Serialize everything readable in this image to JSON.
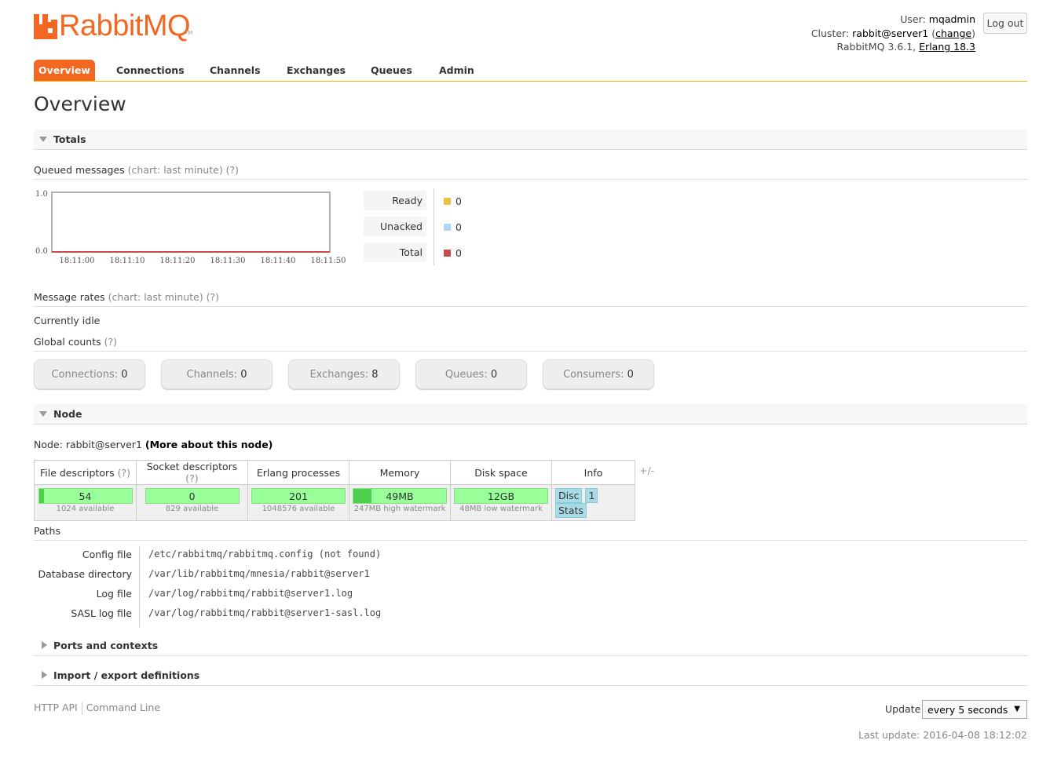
{
  "header": {
    "logo_text": "RabbitMQ",
    "logo_tm": "TM",
    "user_label": "User:",
    "user": "mqadmin",
    "cluster_label": "Cluster:",
    "cluster": "rabbit@server1",
    "change_label": "change",
    "version_text": "RabbitMQ 3.6.1,",
    "erlang": "Erlang 18.3",
    "logout": "Log out",
    "accent": "#f26822"
  },
  "tabs": [
    {
      "label": "Overview",
      "active": true
    },
    {
      "label": "Connections"
    },
    {
      "label": "Channels"
    },
    {
      "label": "Exchanges"
    },
    {
      "label": "Queues"
    },
    {
      "label": "Admin"
    }
  ],
  "page_title": "Overview",
  "totals": {
    "title": "Totals",
    "queued_title": "Queued messages",
    "queued_note": "(chart: last minute) (?)",
    "legend": [
      {
        "label": "Ready",
        "value": "0",
        "color": "#edc240"
      },
      {
        "label": "Unacked",
        "value": "0",
        "color": "#afd8f8"
      },
      {
        "label": "Total",
        "value": "0",
        "color": "#cb4b4b"
      }
    ],
    "rates_title": "Message rates",
    "rates_note": "(chart: last minute) (?)",
    "idle": "Currently idle",
    "global_title": "Global counts",
    "global_note": "(?)",
    "counts": [
      {
        "label": "Connections:",
        "value": "0"
      },
      {
        "label": "Channels:",
        "value": "0"
      },
      {
        "label": "Exchanges:",
        "value": "8"
      },
      {
        "label": "Queues:",
        "value": "0"
      },
      {
        "label": "Consumers:",
        "value": "0"
      }
    ]
  },
  "chart_data": {
    "type": "line",
    "x": [
      "18:11:00",
      "18:11:10",
      "18:11:20",
      "18:11:30",
      "18:11:40",
      "18:11:50"
    ],
    "series": [
      {
        "name": "Ready",
        "values": [
          0,
          0,
          0,
          0,
          0,
          0
        ],
        "color": "#edc240"
      },
      {
        "name": "Unacked",
        "values": [
          0,
          0,
          0,
          0,
          0,
          0
        ],
        "color": "#afd8f8"
      },
      {
        "name": "Total",
        "values": [
          0,
          0,
          0,
          0,
          0,
          0
        ],
        "color": "#cb4b4b"
      }
    ],
    "yticks": [
      "0.0",
      "1.0"
    ],
    "ylim": [
      0,
      1
    ]
  },
  "node": {
    "title": "Node",
    "node_label": "Node:",
    "node_name": "rabbit@server1",
    "more_link": "(More about this node)",
    "columns": [
      {
        "head": "File descriptors",
        "q": "(?)"
      },
      {
        "head": "Socket descriptors",
        "q": "(?)"
      },
      {
        "head": "Erlang processes",
        "q": ""
      },
      {
        "head": "Memory",
        "q": ""
      },
      {
        "head": "Disk space",
        "q": ""
      },
      {
        "head": "Info",
        "q": ""
      }
    ],
    "cells": [
      {
        "value": "54",
        "sub": "1024 available",
        "fill": 0.053
      },
      {
        "value": "0",
        "sub": "829 available",
        "fill": 0
      },
      {
        "value": "201",
        "sub": "1048576 available",
        "fill": 0.0002
      },
      {
        "value": "49MB",
        "sub": "247MB high watermark",
        "fill": 0.198
      },
      {
        "value": "12GB",
        "sub": "48MB low watermark",
        "fill": 0
      }
    ],
    "info_badges": [
      "Disc",
      "1",
      "Stats"
    ],
    "plusminus": "+/-"
  },
  "paths": {
    "title": "Paths",
    "rows": [
      {
        "label": "Config file",
        "value": "/etc/rabbitmq/rabbitmq.config (not found)"
      },
      {
        "label": "Database directory",
        "value": "/var/lib/rabbitmq/mnesia/rabbit@server1"
      },
      {
        "label": "Log file",
        "value": "/var/log/rabbitmq/rabbit@server1.log"
      },
      {
        "label": "SASL log file",
        "value": "/var/log/rabbitmq/rabbit@server1-sasl.log"
      }
    ]
  },
  "collapsed_sections": [
    "Ports and contexts",
    "Import / export definitions"
  ],
  "footer": {
    "http_api": "HTTP API",
    "command_line": "Command Line",
    "update_label": "Update",
    "update_value": "every 5 seconds",
    "last_update": "Last update: 2016-04-08 18:12:02"
  }
}
